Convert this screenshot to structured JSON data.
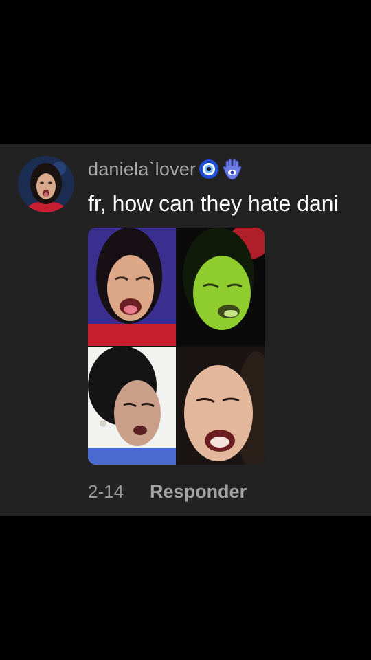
{
  "comment": {
    "username": "daniela`lover",
    "badges": [
      "nazar-amulet-icon",
      "hamsa-hand-icon"
    ],
    "text": "fr, how can they hate dani",
    "date": "2-14",
    "reply_label": "Responder",
    "attachment": {
      "type": "image-collage",
      "tiles": [
        "photo-top-left",
        "photo-top-right-green",
        "photo-bottom-left",
        "photo-bottom-right"
      ]
    }
  },
  "colors": {
    "background": "#000000",
    "card": "#222222",
    "username": "#a9a9a9",
    "text": "#ffffff",
    "meta": "#9a9a9a"
  }
}
